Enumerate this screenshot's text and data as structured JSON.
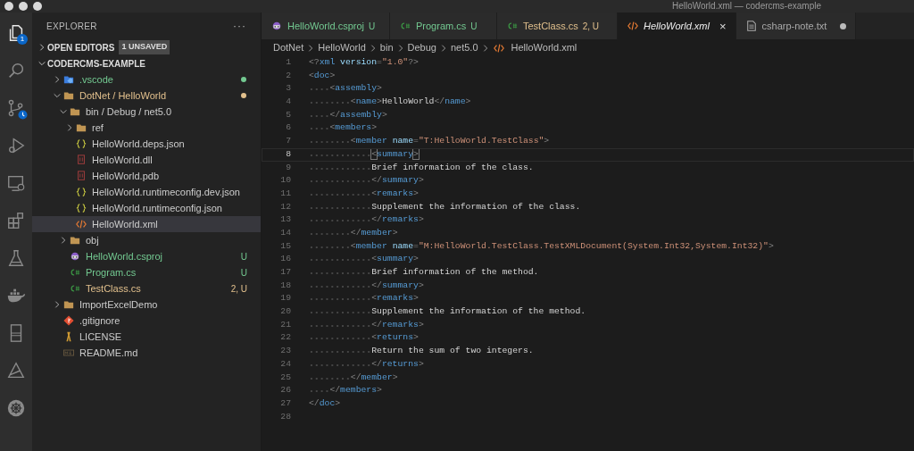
{
  "window": {
    "title": "HelloWorld.xml — codercms-example"
  },
  "activity_bar": [
    {
      "kind": "files",
      "selected": true,
      "badge": "1"
    },
    {
      "kind": "search",
      "selected": false
    },
    {
      "kind": "source-control",
      "selected": false,
      "progress": true
    },
    {
      "kind": "run",
      "selected": false
    },
    {
      "kind": "monitor",
      "selected": false
    },
    {
      "kind": "extensions",
      "selected": false
    },
    {
      "kind": "flask",
      "selected": false
    },
    {
      "kind": "whale",
      "selected": false
    },
    {
      "kind": "book",
      "selected": false
    },
    {
      "kind": "triangle",
      "selected": false
    },
    {
      "kind": "wheel",
      "selected": false
    }
  ],
  "sidebar": {
    "title": "EXPLORER",
    "more": "···",
    "open_editors": {
      "label": "OPEN EDITORS",
      "expanded": false,
      "badge": "1 UNSAVED"
    },
    "folder": {
      "label": "CODERCMS-EXAMPLE",
      "expanded": true,
      "items": [
        {
          "name": ".vscode",
          "kind": "vscode-folder",
          "expanded": false,
          "color": "#73c991",
          "selected": false
        },
        {
          "name": "DotNet / HelloWorld",
          "kind": "folder",
          "expanded": true,
          "color": "#e2c08d",
          "selected": false,
          "children": [
            {
              "name": "bin / Debug / net5.0",
              "kind": "folder",
              "expanded": true,
              "selected": false,
              "children": [
                {
                  "name": "ref",
                  "kind": "folder",
                  "expanded": false,
                  "selected": false
                },
                {
                  "name": "HelloWorld.deps.json",
                  "kind": "json",
                  "selected": false
                },
                {
                  "name": "HelloWorld.dll",
                  "kind": "binary",
                  "selected": false
                },
                {
                  "name": "HelloWorld.pdb",
                  "kind": "binary",
                  "selected": false
                },
                {
                  "name": "HelloWorld.runtimeconfig.dev.json",
                  "kind": "json",
                  "selected": false
                },
                {
                  "name": "HelloWorld.runtimeconfig.json",
                  "kind": "json",
                  "selected": false
                },
                {
                  "name": "HelloWorld.xml",
                  "kind": "xml",
                  "selected": true
                }
              ]
            },
            {
              "name": "obj",
              "kind": "folder",
              "expanded": false,
              "selected": false
            },
            {
              "name": "HelloWorld.csproj",
              "kind": "csproj",
              "color": "#73c991",
              "badge": "U",
              "selected": false
            },
            {
              "name": "Program.cs",
              "kind": "csharp",
              "color": "#73c991",
              "badge": "U",
              "selected": false
            },
            {
              "name": "TestClass.cs",
              "kind": "csharp",
              "color": "#e2c08d",
              "badge": "2, U",
              "selected": false
            }
          ]
        },
        {
          "name": "ImportExcelDemo",
          "kind": "folder",
          "expanded": false,
          "selected": false
        },
        {
          "name": ".gitignore",
          "kind": "git",
          "selected": false
        },
        {
          "name": "LICENSE",
          "kind": "license",
          "selected": false
        },
        {
          "name": "README.md",
          "kind": "markdown",
          "selected": false
        }
      ]
    }
  },
  "tabs": [
    {
      "label": "HelloWorld.csproj",
      "kind": "csproj",
      "color": "#73c991",
      "status": "U",
      "selected": false
    },
    {
      "label": "Program.cs",
      "kind": "csharp",
      "color": "#73c991",
      "status": "U",
      "selected": false
    },
    {
      "label": "TestClass.cs",
      "kind": "csharp",
      "color": "#e2c08d",
      "status": "2, U",
      "selected": false
    },
    {
      "label": "HelloWorld.xml",
      "kind": "xml",
      "selected": true,
      "preview": true,
      "close": "×"
    },
    {
      "label": "csharp-note.txt",
      "kind": "text",
      "selected": false,
      "dirty": true
    }
  ],
  "breadcrumb": [
    {
      "label": "DotNet"
    },
    {
      "label": "HelloWorld"
    },
    {
      "label": "bin"
    },
    {
      "label": "Debug"
    },
    {
      "label": "net5.0"
    },
    {
      "label": "HelloWorld.xml",
      "kind": "xml"
    }
  ],
  "editor": {
    "lines": [
      {
        "number": "1",
        "current": false,
        "tokens": [
          {
            "kind": "punct",
            "text": "<?"
          },
          {
            "kind": "tag",
            "text": "xml"
          },
          {
            "kind": "attr",
            "text": " version"
          },
          {
            "kind": "punct",
            "text": "="
          },
          {
            "kind": "string",
            "text": "\"1.0\""
          },
          {
            "kind": "punct",
            "text": "?>"
          }
        ]
      },
      {
        "number": "2",
        "current": false,
        "tokens": [
          {
            "kind": "punct",
            "text": "<"
          },
          {
            "kind": "tag",
            "text": "doc"
          },
          {
            "kind": "punct",
            "text": ">"
          }
        ]
      },
      {
        "number": "3",
        "current": false,
        "tokens": [
          {
            "kind": "punct",
            "text": "    <"
          },
          {
            "kind": "tag",
            "text": "assembly"
          },
          {
            "kind": "punct",
            "text": ">"
          }
        ]
      },
      {
        "number": "4",
        "current": false,
        "tokens": [
          {
            "kind": "punct",
            "text": "        <"
          },
          {
            "kind": "tag",
            "text": "name"
          },
          {
            "kind": "punct",
            "text": ">"
          },
          {
            "kind": "text",
            "text": "HelloWorld"
          },
          {
            "kind": "punct",
            "text": "</"
          },
          {
            "kind": "tag",
            "text": "name"
          },
          {
            "kind": "punct",
            "text": ">"
          }
        ]
      },
      {
        "number": "5",
        "current": false,
        "tokens": [
          {
            "kind": "punct",
            "text": "    </"
          },
          {
            "kind": "tag",
            "text": "assembly"
          },
          {
            "kind": "punct",
            "text": ">"
          }
        ]
      },
      {
        "number": "6",
        "current": false,
        "tokens": [
          {
            "kind": "punct",
            "text": "    <"
          },
          {
            "kind": "tag",
            "text": "members"
          },
          {
            "kind": "punct",
            "text": ">"
          }
        ]
      },
      {
        "number": "7",
        "current": false,
        "tokens": [
          {
            "kind": "punct",
            "text": "        <"
          },
          {
            "kind": "tag",
            "text": "member"
          },
          {
            "kind": "attr",
            "text": " name"
          },
          {
            "kind": "punct",
            "text": "="
          },
          {
            "kind": "string",
            "text": "\"T:HelloWorld.TestClass\""
          },
          {
            "kind": "punct",
            "text": ">"
          }
        ]
      },
      {
        "number": "8",
        "current": true,
        "tokens": [
          {
            "kind": "match",
            "text": "            <"
          },
          {
            "kind": "tag",
            "text": "summary"
          },
          {
            "kind": "match",
            "text": ">"
          }
        ]
      },
      {
        "number": "9",
        "current": false,
        "tokens": [
          {
            "kind": "text",
            "text": "            Brief information of the class."
          }
        ]
      },
      {
        "number": "10",
        "current": false,
        "tokens": [
          {
            "kind": "punct",
            "text": "            </"
          },
          {
            "kind": "tag",
            "text": "summary"
          },
          {
            "kind": "punct",
            "text": ">"
          }
        ]
      },
      {
        "number": "11",
        "current": false,
        "tokens": [
          {
            "kind": "punct",
            "text": "            <"
          },
          {
            "kind": "tag",
            "text": "remarks"
          },
          {
            "kind": "punct",
            "text": ">"
          }
        ]
      },
      {
        "number": "12",
        "current": false,
        "tokens": [
          {
            "kind": "text",
            "text": "            Supplement the information of the class."
          }
        ]
      },
      {
        "number": "13",
        "current": false,
        "tokens": [
          {
            "kind": "punct",
            "text": "            </"
          },
          {
            "kind": "tag",
            "text": "remarks"
          },
          {
            "kind": "punct",
            "text": ">"
          }
        ]
      },
      {
        "number": "14",
        "current": false,
        "tokens": [
          {
            "kind": "punct",
            "text": "        </"
          },
          {
            "kind": "tag",
            "text": "member"
          },
          {
            "kind": "punct",
            "text": ">"
          }
        ]
      },
      {
        "number": "15",
        "current": false,
        "tokens": [
          {
            "kind": "punct",
            "text": "        <"
          },
          {
            "kind": "tag",
            "text": "member"
          },
          {
            "kind": "attr",
            "text": " name"
          },
          {
            "kind": "punct",
            "text": "="
          },
          {
            "kind": "string",
            "text": "\"M:HelloWorld.TestClass.TestXMLDocument(System.Int32,System.Int32)\""
          },
          {
            "kind": "punct",
            "text": ">"
          }
        ]
      },
      {
        "number": "16",
        "current": false,
        "tokens": [
          {
            "kind": "punct",
            "text": "            <"
          },
          {
            "kind": "tag",
            "text": "summary"
          },
          {
            "kind": "punct",
            "text": ">"
          }
        ]
      },
      {
        "number": "17",
        "current": false,
        "tokens": [
          {
            "kind": "text",
            "text": "            Brief information of the method."
          }
        ]
      },
      {
        "number": "18",
        "current": false,
        "tokens": [
          {
            "kind": "punct",
            "text": "            </"
          },
          {
            "kind": "tag",
            "text": "summary"
          },
          {
            "kind": "punct",
            "text": ">"
          }
        ]
      },
      {
        "number": "19",
        "current": false,
        "tokens": [
          {
            "kind": "punct",
            "text": "            <"
          },
          {
            "kind": "tag",
            "text": "remarks"
          },
          {
            "kind": "punct",
            "text": ">"
          }
        ]
      },
      {
        "number": "20",
        "current": false,
        "tokens": [
          {
            "kind": "text",
            "text": "            Supplement the information of the method."
          }
        ]
      },
      {
        "number": "21",
        "current": false,
        "tokens": [
          {
            "kind": "punct",
            "text": "            </"
          },
          {
            "kind": "tag",
            "text": "remarks"
          },
          {
            "kind": "punct",
            "text": ">"
          }
        ]
      },
      {
        "number": "22",
        "current": false,
        "tokens": [
          {
            "kind": "punct",
            "text": "            <"
          },
          {
            "kind": "tag",
            "text": "returns"
          },
          {
            "kind": "punct",
            "text": ">"
          }
        ]
      },
      {
        "number": "23",
        "current": false,
        "tokens": [
          {
            "kind": "text",
            "text": "            Return the sum of two integers."
          }
        ]
      },
      {
        "number": "24",
        "current": false,
        "tokens": [
          {
            "kind": "punct",
            "text": "            </"
          },
          {
            "kind": "tag",
            "text": "returns"
          },
          {
            "kind": "punct",
            "text": ">"
          }
        ]
      },
      {
        "number": "25",
        "current": false,
        "tokens": [
          {
            "kind": "punct",
            "text": "        </"
          },
          {
            "kind": "tag",
            "text": "member"
          },
          {
            "kind": "punct",
            "text": ">"
          }
        ]
      },
      {
        "number": "26",
        "current": false,
        "tokens": [
          {
            "kind": "punct",
            "text": "    </"
          },
          {
            "kind": "tag",
            "text": "members"
          },
          {
            "kind": "punct",
            "text": ">"
          }
        ]
      },
      {
        "number": "27",
        "current": false,
        "tokens": [
          {
            "kind": "punct",
            "text": "</"
          },
          {
            "kind": "tag",
            "text": "doc"
          },
          {
            "kind": "punct",
            "text": ">"
          }
        ]
      },
      {
        "number": "28",
        "current": false
      }
    ]
  }
}
